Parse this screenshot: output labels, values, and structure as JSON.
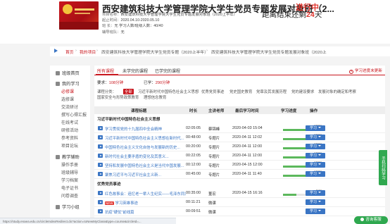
{
  "header": {
    "course_title": "西安建筑科技大学管理学院大学生党员专题发展对象班（2...",
    "status": "进行中",
    "course_name_label": "项目名称：",
    "course_name": "西安建筑科技大学管理学院大学生党员专题发展对象班（2020上半年）",
    "period_label": "起止时间：",
    "period": "2020.04.10-2020.05.10",
    "students_label": "班    长：",
    "students": "无    学习人数/班级人数：40/40",
    "class_teacher_label": "辅导班队：",
    "class_teacher": "无",
    "countdown_prefix": "距离结束还剩",
    "countdown_days": "24",
    "countdown_suffix": "天"
  },
  "breadcrumb": {
    "home": "首页",
    "sep1": "›",
    "my_courses": "我的项目",
    "sep2": "›",
    "project": "西安建筑科技大学管理学院大学生党员专题（2020上半年）",
    "sep3": "›",
    "current": "西安建筑科技大学管理学院大学生党员专题发展对象班（2020上"
  },
  "sidebar": {
    "home": "班级首页",
    "my_learning": "我的学习",
    "items": [
      "必修课",
      "选修课",
      "交流研讨",
      "撰写心得汇报",
      "在线考试",
      "研修活动",
      "参考资料",
      "项目论坛"
    ],
    "teaching_group": "教学辅助",
    "teaching_items": [
      "操作手册",
      "班级辅导",
      "学习档案",
      "电子证书",
      "问卷调查"
    ],
    "study_group": "学习小组"
  },
  "tabs": {
    "all": "所有课程",
    "unstudied": "未学完的课程",
    "studied": "已学完的课程",
    "help": "学习进度未更新"
  },
  "requirements": {
    "required_label": "要求：",
    "required_value": "108分钟",
    "done_label": "已学：",
    "done_value": "290分钟"
  },
  "categories": {
    "label": "课程分类：",
    "all": "全部",
    "items": [
      "习近平新时代中国特色社会主义思想",
      "优秀党员事迹",
      "党史国史教育",
      "党章及其发展历程",
      "党的建设要求",
      "发展对象的确定和考察"
    ],
    "items_row2": [
      "国家安全与形势政策教育",
      "理想信念教育"
    ]
  },
  "table": {
    "headers": [
      "课程标题",
      "时长",
      "主讲老师",
      "最后学习时间",
      "学习进度",
      "操作"
    ],
    "section1": "习近平新时代中国特色社会主义思想",
    "section2": "优秀党员事迹",
    "rows": [
      {
        "title": "学习贯彻党的十九届四中全会精神",
        "duration": "02:05:05",
        "teacher": "蔡锦峰",
        "last": "2020-04-03 15:04",
        "progress": 100,
        "pct": "100%",
        "action": "学习"
      },
      {
        "title": "习近平新时代中国特色社会主义思想在新时代...",
        "duration": "00:48:00",
        "teacher": "专题片",
        "last": "2020-04-11 12:02",
        "progress": 100,
        "pct": "100%",
        "action": "学习"
      },
      {
        "title": "中国特色社会主义文化自信与发展新的历史...",
        "duration": "00:20:00",
        "teacher": "专题片",
        "last": "2020-04-11 12:00",
        "progress": 100,
        "pct": "100%",
        "action": "学习"
      },
      {
        "title": "新时代社会主要矛盾的变化及其意义...",
        "duration": "00:22:05",
        "teacher": "专题片",
        "last": "2020-04-11 12:00",
        "progress": 100,
        "pct": "100%",
        "action": "学习"
      },
      {
        "title": "坚持和发展中国特色社会主义是当代中国发展...",
        "duration": "00:12:00",
        "teacher": "专题片",
        "last": "2020-04-15 12:00",
        "progress": 100,
        "pct": "100%",
        "action": "学习"
      },
      {
        "title": "聚焦习近平与习近平社会主义新...",
        "duration": "00:45:00",
        "teacher": "专题片",
        "last": "2020-04-11 11:40",
        "progress": 100,
        "pct": "100%",
        "action": "学习"
      },
      {
        "title": "红色故事会：追忆老一辈人生纪实——毛泽东同志...",
        "duration": "00:35:00",
        "teacher": "董宏",
        "last": "2020-04-15 16:16",
        "progress": 34,
        "pct": "34%",
        "action": "学习"
      },
      {
        "title": "学习英雄事迹",
        "tag": "NEW",
        "duration": "00:11:21",
        "teacher": "微课",
        "last": "",
        "progress": 0,
        "pct": "",
        "action": "学习"
      },
      {
        "title": "抗疫\"硬仗\"前线篇",
        "duration": "00:09:51",
        "teacher": "微课",
        "last": "",
        "progress": 0,
        "pct": "",
        "action": "学习"
      }
    ]
  },
  "float": {
    "tab_label": "手机扫码学习",
    "consult": "咨询客服"
  },
  "statusbar": "https://study.enaea.edu.cn/circleIndexRedirect.do?action=toNewMyClass&type=course&circleId=..."
}
